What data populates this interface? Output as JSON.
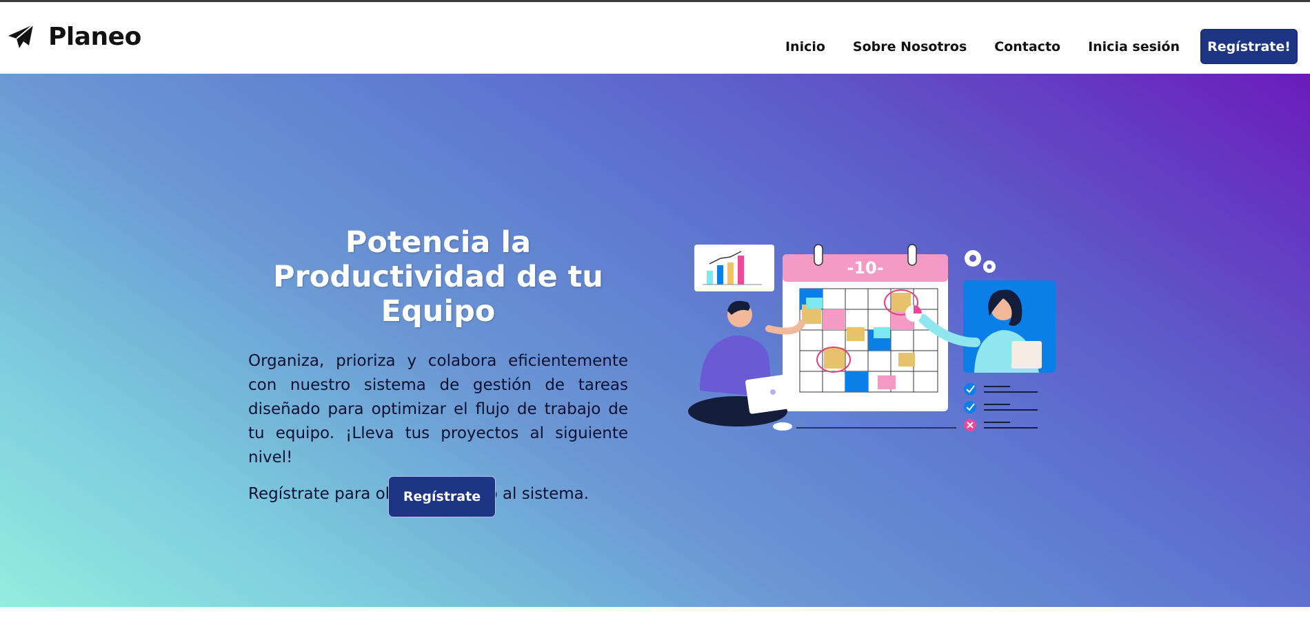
{
  "header": {
    "brand": "Planeo",
    "brand_icon": "paper-plane-icon",
    "nav": {
      "inicio": "Inicio",
      "sobre": "Sobre Nosotros",
      "contacto": "Contacto",
      "login": "Inicia sesión",
      "register": "Regístrate!"
    }
  },
  "hero": {
    "title": "Potencia la Productividad de tu Equipo",
    "body": "Organiza, prioriza y colabora eficientemente con nuestro sistema de gestión de tareas diseñado para optimizar el flujo de trabajo de tu equipo. ¡Lleva tus proyectos al siguiente nivel!",
    "cta_text": "Regístrate para obtener acceso al sistema.",
    "button": "Regístrate",
    "illustration": {
      "calendar_label": "-10-",
      "icons": [
        "calendar-icon",
        "bar-chart-icon",
        "gear-icon",
        "check-icon",
        "cross-icon"
      ]
    }
  },
  "colors": {
    "primary": "#1e3585",
    "gradient_start": "#94ecdf",
    "gradient_end": "#6b1cbb",
    "calendar_header": "#f59ac4",
    "accent_blue": "#0a7fe8"
  }
}
